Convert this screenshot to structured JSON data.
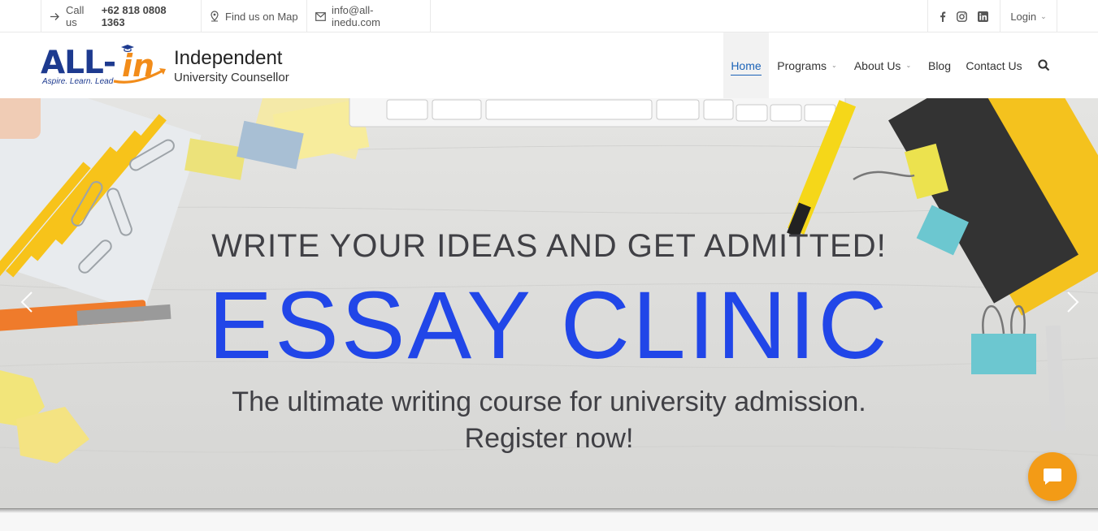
{
  "topbar": {
    "call_prefix": "Call us",
    "call_number": "+62 818 0808 1363",
    "map_label": "Find us on Map",
    "email": "info@all-inedu.com",
    "social": [
      "facebook-icon",
      "instagram-icon",
      "linkedin-icon"
    ],
    "login_label": "Login"
  },
  "logo": {
    "mark_all": "ALL-",
    "mark_in": "in",
    "tagline": "Aspire. Learn. Lead",
    "title": "Independent",
    "subtitle": "University Counsellor"
  },
  "nav": {
    "items": [
      {
        "label": "Home",
        "active": true
      },
      {
        "label": "Programs",
        "dropdown": true
      },
      {
        "label": "About Us",
        "dropdown": true
      },
      {
        "label": "Blog"
      },
      {
        "label": "Contact Us"
      }
    ],
    "search_icon": "search-icon"
  },
  "hero": {
    "line1": "WRITE YOUR IDEAS AND GET ADMITTED!",
    "line2": "ESSAY CLINIC",
    "line3": "The ultimate writing course for university admission.",
    "line4": "Register now!",
    "prev_icon": "chevron-left-icon",
    "next_icon": "chevron-right-icon"
  },
  "chat": {
    "icon": "chat-bubble-icon"
  },
  "colors": {
    "accent_blue": "#1b63b8",
    "hero_blue": "#2146e8",
    "chat_orange": "#f39b16",
    "logo_navy": "#1d3a8f",
    "logo_orange": "#f28c1a"
  }
}
